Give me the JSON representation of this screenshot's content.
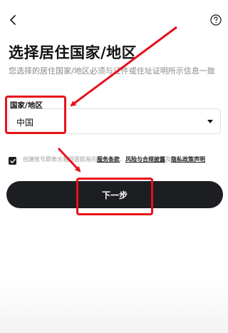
{
  "header": {
    "back_icon": "chevron-left-icon",
    "help_icon": "question-circle-icon"
  },
  "page": {
    "title": "选择居住国家/地区",
    "subtitle": "您选择的居住国家/地区必须与证件或住址证明所示信息一致"
  },
  "form": {
    "country_label": "国家/地区",
    "country_value": "中国",
    "dropdown_icon": "caret-down-icon"
  },
  "agreement": {
    "checked": true,
    "prefix": "创建账号即表示我同意欧易的",
    "terms_link": "服务条款",
    "sep1": "、",
    "risk_link": "风险与合规披露",
    "sep2": "及",
    "privacy_link": "隐私政策声明"
  },
  "actions": {
    "next_label": "下一步"
  },
  "annotations": {
    "highlight_color": "#e8101a"
  }
}
